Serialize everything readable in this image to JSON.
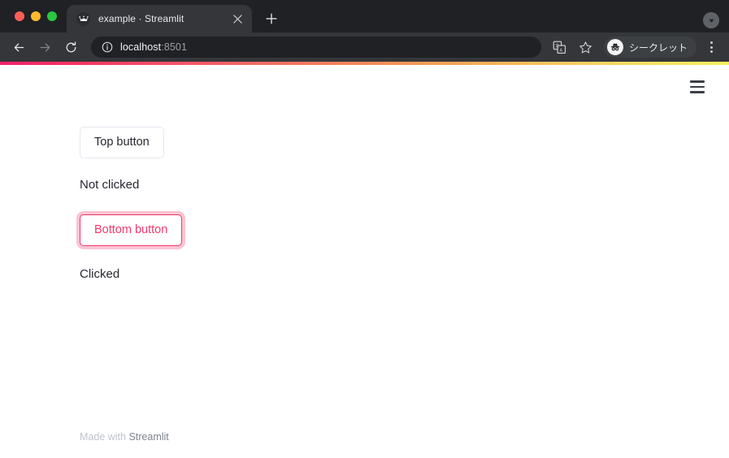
{
  "browser": {
    "window_controls": [
      "close",
      "minimize",
      "maximize"
    ],
    "tab": {
      "title": "example · Streamlit",
      "favicon_name": "streamlit-crown-favicon",
      "close_label": "×"
    },
    "new_tab_label": "+",
    "toolbar": {
      "back_label": "←",
      "forward_label": "→",
      "reload_label": "⟳",
      "url_main": "localhost",
      "url_port": ":8501",
      "url_full": "localhost:8501",
      "translate_icon": "translate-icon",
      "bookmark_icon": "star-icon",
      "incognito_label": "シークレット",
      "menu_icon": "kebab-menu-icon"
    },
    "tabstrip_right_icon": "profile-chevron-icon"
  },
  "page": {
    "menu_label": "≡",
    "top_button": "Top button",
    "top_status": "Not clicked",
    "bottom_button": "Bottom button",
    "bottom_status": "Clicked",
    "footer_prefix": "Made with ",
    "footer_link": "Streamlit",
    "accent_color": "#f6386b",
    "text_color": "#262730"
  }
}
